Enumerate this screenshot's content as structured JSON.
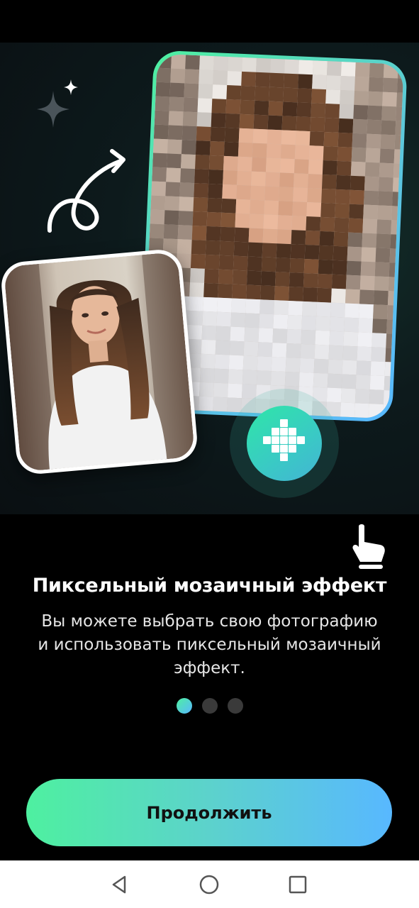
{
  "onboarding": {
    "title": "Пиксельный мозаичный эффект",
    "description": "Вы можете выбрать свою фотографию и использовать пиксельный мозаичный эффект.",
    "page_indicator": {
      "total": 3,
      "active": 1
    },
    "continue_label": "Продолжить"
  },
  "colors": {
    "accent_start": "#4ef0a0",
    "accent_end": "#58b8ff",
    "background": "#000000",
    "dot_inactive": "#3a3a3a"
  },
  "icons": {
    "sparkles": "sparkle-icon",
    "arrow": "swirl-arrow-icon",
    "mosaic": "mosaic-icon",
    "hand": "pointing-hand-icon",
    "nav_back": "back-triangle-icon",
    "nav_home": "home-circle-icon",
    "nav_recents": "recents-square-icon"
  }
}
